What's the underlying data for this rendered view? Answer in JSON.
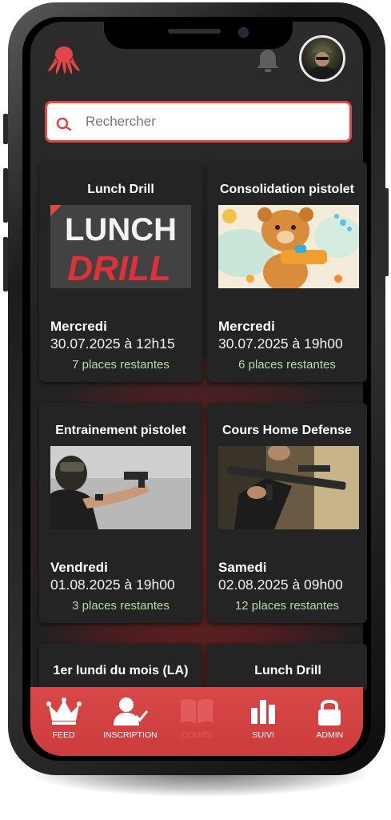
{
  "search": {
    "placeholder": "Rechercher"
  },
  "courses": [
    {
      "title": "Lunch Drill",
      "day": "Mercredi",
      "date": "30.07.2025 à 12h15",
      "places": "7 places restantes",
      "image_text_1": "LUNCH",
      "image_text_2": "DRILL"
    },
    {
      "title": "Consolidation pistolet",
      "day": "Mercredi",
      "date": "30.07.2025 à 19h00",
      "places": "6 places restantes"
    },
    {
      "title": "Entrainement pistolet",
      "day": "Vendredi",
      "date": "01.08.2025 à 19h00",
      "places": "3 places restantes"
    },
    {
      "title": "Cours Home Defense",
      "day": "Samedi",
      "date": "02.08.2025 à 09h00",
      "places": "12 places restantes"
    },
    {
      "title": "1er lundi du mois (LA)"
    },
    {
      "title": "Lunch Drill"
    }
  ],
  "nav": [
    {
      "label": "FEED",
      "icon": "crown-icon"
    },
    {
      "label": "INSCRIPTION",
      "icon": "user-check-icon"
    },
    {
      "label": "COURS",
      "icon": "book-icon",
      "active": true
    },
    {
      "label": "SUIVI",
      "icon": "bar-chart-icon"
    },
    {
      "label": "ADMIN",
      "icon": "lock-icon"
    }
  ],
  "colors": {
    "accent": "#e04848",
    "nav_bg": "#d94848",
    "places_text": "#b8d8a8",
    "card_bg": "#242424"
  }
}
